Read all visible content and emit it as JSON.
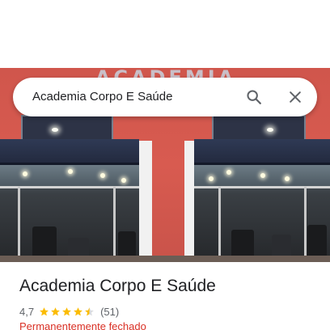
{
  "search": {
    "query": "Academia Corpo E Saúde"
  },
  "photo": {
    "sign_text": "ACADEMIA"
  },
  "place": {
    "name": "Academia Corpo E Saúde",
    "rating": "4,7",
    "stars": 4.5,
    "reviews": "(51)",
    "status": "Permanentemente fechado"
  },
  "icons": {
    "search": "search-icon",
    "close": "close-icon",
    "star": "star-icon"
  },
  "colors": {
    "star": "#fbbc04",
    "status": "#d93025",
    "wall": "#d85b50"
  }
}
